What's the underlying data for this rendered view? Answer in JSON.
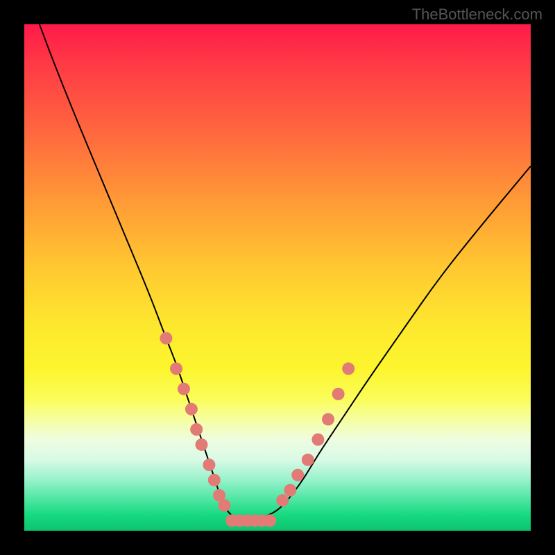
{
  "watermark": "TheBottleneck.com",
  "colors": {
    "background": "#000000",
    "dot": "#e27b75",
    "curve": "#000000"
  },
  "chart_data": {
    "type": "line",
    "title": "",
    "xlabel": "",
    "ylabel": "",
    "xlim": [
      0,
      100
    ],
    "ylim": [
      0,
      100
    ],
    "curve": {
      "x": [
        3,
        6,
        10,
        15,
        20,
        25,
        28,
        30,
        32,
        34,
        36,
        37,
        38,
        39,
        40,
        41,
        42,
        44,
        46,
        48,
        50,
        52,
        55,
        58,
        62,
        68,
        75,
        82,
        90,
        100
      ],
      "y": [
        100,
        92,
        82,
        70,
        58,
        46,
        38,
        33,
        27,
        21,
        15,
        12,
        9,
        6,
        4,
        3,
        2,
        2,
        2,
        3,
        4,
        6,
        10,
        15,
        21,
        30,
        40,
        50,
        60,
        72
      ]
    },
    "series": [
      {
        "name": "scatter-left",
        "type": "scatter",
        "x": [
          28,
          30,
          31.5,
          33,
          34,
          35,
          36.5,
          37.5,
          38.5,
          39.5
        ],
        "y": [
          38,
          32,
          28,
          24,
          20,
          17,
          13,
          10,
          7,
          5
        ]
      },
      {
        "name": "scatter-bottom",
        "type": "scatter",
        "x": [
          41,
          42.5,
          44,
          45.5,
          47,
          48.5
        ],
        "y": [
          2,
          2,
          2,
          2,
          2,
          2
        ]
      },
      {
        "name": "scatter-right",
        "type": "scatter",
        "x": [
          51,
          52.5,
          54,
          56,
          58,
          60,
          62,
          64
        ],
        "y": [
          6,
          8,
          11,
          14,
          18,
          22,
          27,
          32
        ]
      }
    ]
  }
}
